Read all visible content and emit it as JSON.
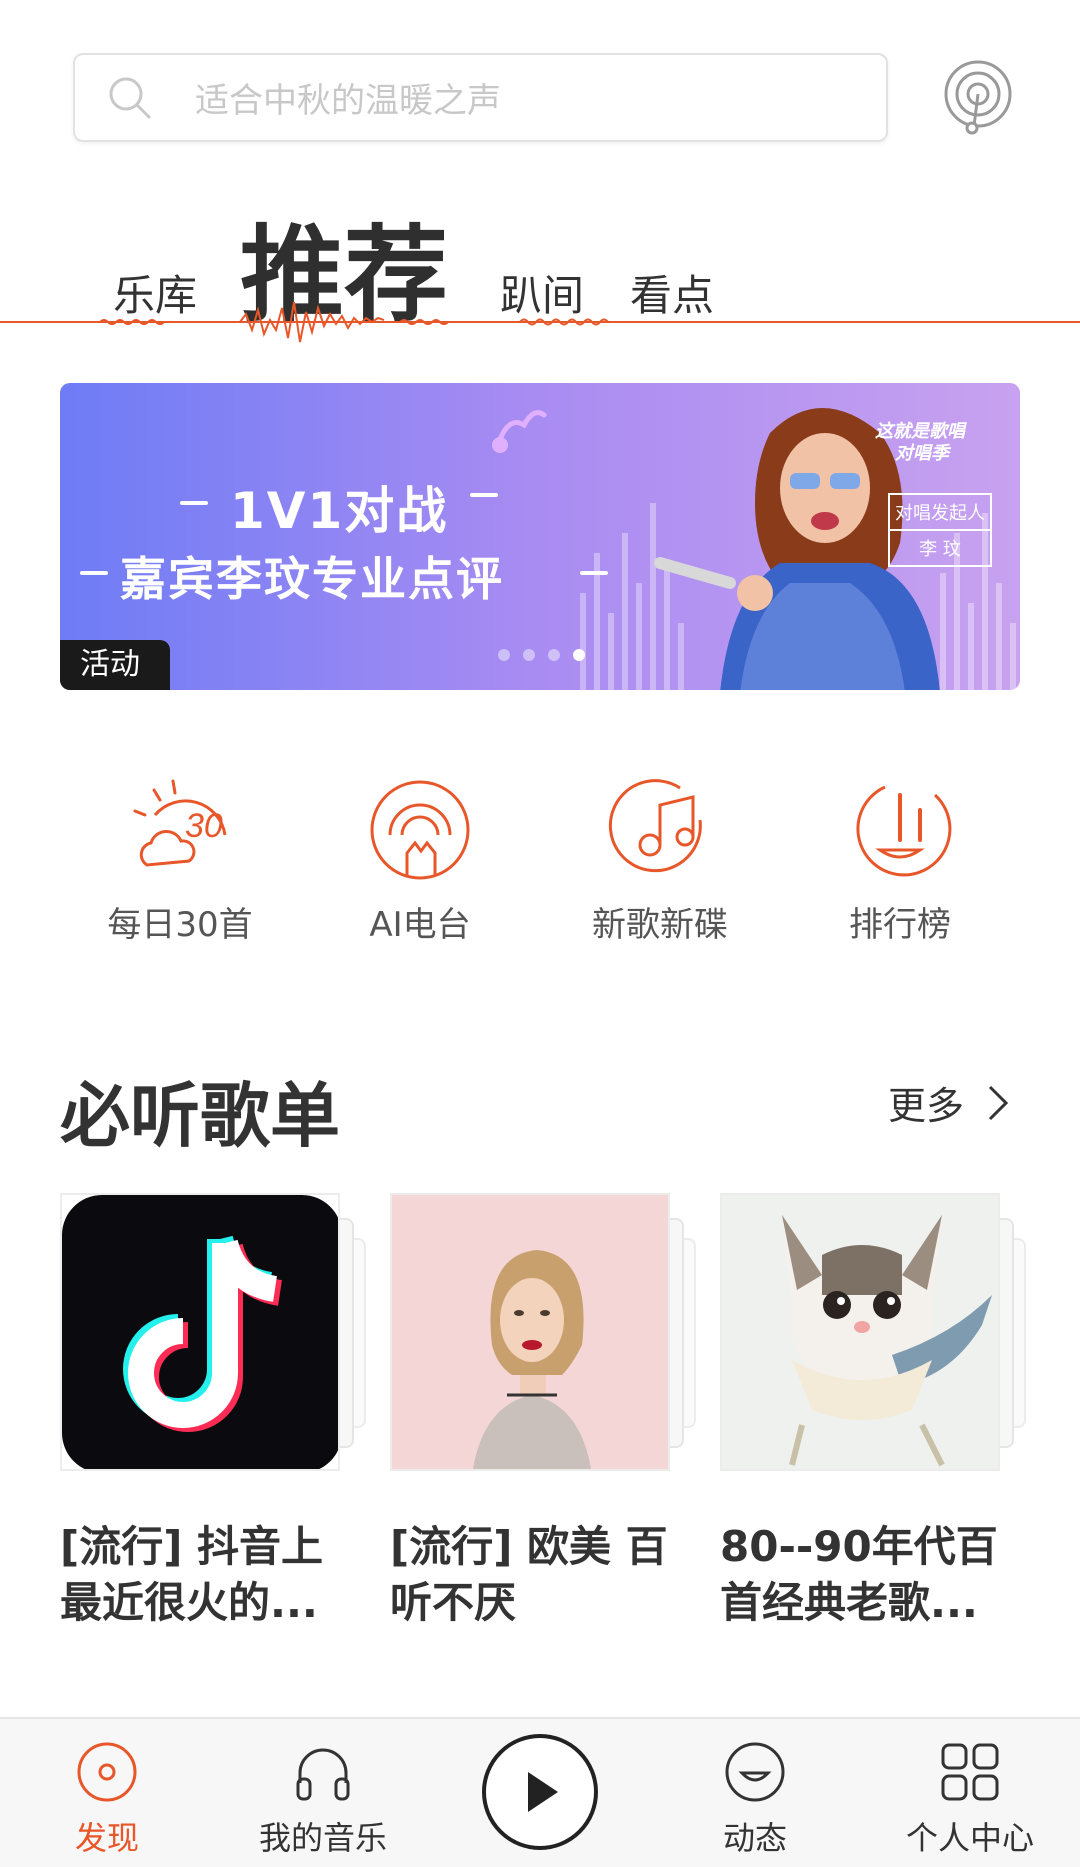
{
  "search": {
    "placeholder": "适合中秋的温暖之声"
  },
  "tabs": [
    {
      "label": "乐库"
    },
    {
      "label": "推荐"
    },
    {
      "label": "趴间"
    },
    {
      "label": "看点"
    }
  ],
  "banner": {
    "line1": "1V1对战",
    "line2": "嘉宾李玟专业点评",
    "logo_line1": "这就是歌唱",
    "logo_line2": "对唱季",
    "badge_title": "对唱发起人",
    "badge_name": "李 玟",
    "tag": "活动",
    "page_count": 4,
    "active_page": 4
  },
  "shortcuts": [
    {
      "label": "每日30首",
      "icon": "daily-30-icon"
    },
    {
      "label": "AI电台",
      "icon": "ai-radio-icon"
    },
    {
      "label": "新歌新碟",
      "icon": "new-disc-icon"
    },
    {
      "label": "排行榜",
      "icon": "chart-rank-icon"
    }
  ],
  "section": {
    "title": "必听歌单",
    "more": "更多"
  },
  "playlists": [
    {
      "title": "[流行] 抖音上最近很火的..."
    },
    {
      "title": "[流行] 欧美 百听不厌"
    },
    {
      "title": " 80--90年代百首经典老歌..."
    }
  ],
  "nav": {
    "items": [
      {
        "label": "发现",
        "icon": "discover-icon"
      },
      {
        "label": "我的音乐",
        "icon": "headphones-icon"
      },
      {
        "label": "动态",
        "icon": "smile-icon"
      },
      {
        "label": "个人中心",
        "icon": "grid-icon"
      }
    ],
    "play": "play-icon"
  },
  "colors": {
    "accent": "#e8572a",
    "banner_from": "#6e7cf5",
    "banner_to": "#c8a2f0"
  }
}
